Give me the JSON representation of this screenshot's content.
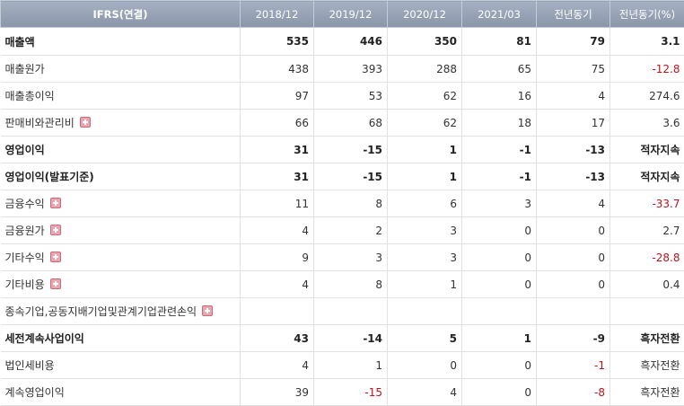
{
  "header": [
    "IFRS(연결)",
    "2018/12",
    "2019/12",
    "2020/12",
    "2021/03",
    "전년동기",
    "전년동기(%)"
  ],
  "rows": [
    {
      "label": "매출액",
      "bold": true,
      "expand": false,
      "values": [
        "535",
        "446",
        "350",
        "81",
        "79",
        "3.1"
      ],
      "neg": [
        false,
        false,
        false,
        false,
        false,
        false
      ]
    },
    {
      "label": "매출원가",
      "bold": false,
      "expand": false,
      "values": [
        "438",
        "393",
        "288",
        "65",
        "75",
        "-12.8"
      ],
      "neg": [
        false,
        false,
        false,
        false,
        false,
        true
      ]
    },
    {
      "label": "매출총이익",
      "bold": false,
      "expand": false,
      "values": [
        "97",
        "53",
        "62",
        "16",
        "4",
        "274.6"
      ],
      "neg": [
        false,
        false,
        false,
        false,
        false,
        false
      ]
    },
    {
      "label": "판매비와관리비",
      "bold": false,
      "expand": true,
      "values": [
        "66",
        "68",
        "62",
        "18",
        "17",
        "3.6"
      ],
      "neg": [
        false,
        false,
        false,
        false,
        false,
        false
      ]
    },
    {
      "label": "영업이익",
      "bold": true,
      "expand": false,
      "values": [
        "31",
        "-15",
        "1",
        "-1",
        "-13",
        "적자지속"
      ],
      "neg": [
        false,
        true,
        false,
        true,
        true,
        false
      ]
    },
    {
      "label": "영업이익(발표기준)",
      "bold": true,
      "expand": false,
      "values": [
        "31",
        "-15",
        "1",
        "-1",
        "-13",
        "적자지속"
      ],
      "neg": [
        false,
        true,
        false,
        true,
        true,
        false
      ]
    },
    {
      "label": "금융수익",
      "bold": false,
      "expand": true,
      "values": [
        "11",
        "8",
        "6",
        "3",
        "4",
        "-33.7"
      ],
      "neg": [
        false,
        false,
        false,
        false,
        false,
        true
      ]
    },
    {
      "label": "금융원가",
      "bold": false,
      "expand": true,
      "values": [
        "4",
        "2",
        "3",
        "0",
        "0",
        "2.7"
      ],
      "neg": [
        false,
        false,
        false,
        false,
        false,
        false
      ]
    },
    {
      "label": "기타수익",
      "bold": false,
      "expand": true,
      "values": [
        "9",
        "3",
        "3",
        "0",
        "0",
        "-28.8"
      ],
      "neg": [
        false,
        false,
        false,
        false,
        false,
        true
      ]
    },
    {
      "label": "기타비용",
      "bold": false,
      "expand": true,
      "values": [
        "4",
        "8",
        "1",
        "0",
        "0",
        "0.4"
      ],
      "neg": [
        false,
        false,
        false,
        false,
        false,
        false
      ]
    },
    {
      "label": "종속기업,공동지배기업및관계기업관련손익",
      "bold": false,
      "expand": true,
      "values": [
        "",
        "",
        "",
        "",
        "",
        ""
      ],
      "neg": [
        false,
        false,
        false,
        false,
        false,
        false
      ]
    },
    {
      "label": "세전계속사업이익",
      "bold": true,
      "expand": false,
      "values": [
        "43",
        "-14",
        "5",
        "1",
        "-9",
        "흑자전환"
      ],
      "neg": [
        false,
        true,
        false,
        false,
        true,
        false
      ]
    },
    {
      "label": "법인세비용",
      "bold": false,
      "expand": false,
      "values": [
        "4",
        "1",
        "0",
        "0",
        "-1",
        "흑자전환"
      ],
      "neg": [
        false,
        false,
        false,
        false,
        true,
        false
      ]
    },
    {
      "label": "계속영업이익",
      "bold": false,
      "expand": false,
      "values": [
        "39",
        "-15",
        "4",
        "0",
        "-8",
        "흑자전환"
      ],
      "neg": [
        false,
        true,
        false,
        false,
        true,
        false
      ]
    }
  ]
}
